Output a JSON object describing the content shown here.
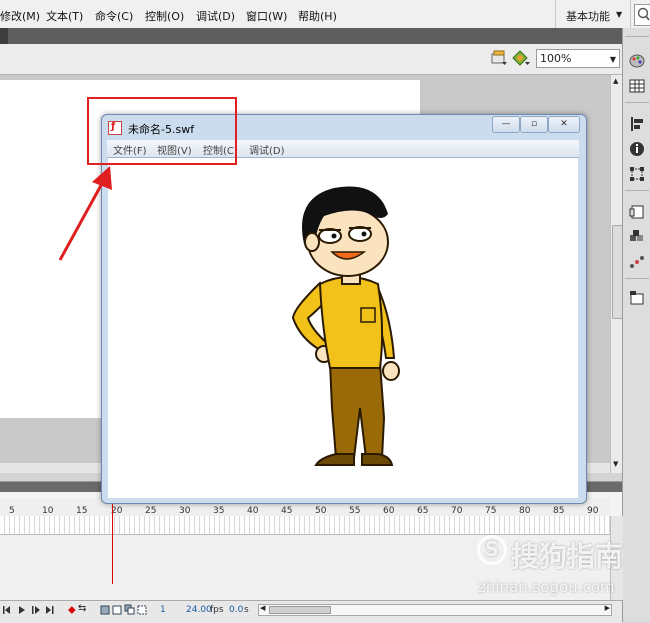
{
  "app": {
    "menu": [
      "修改(M)",
      "文本(T)",
      "命令(C)",
      "控制(O)",
      "调试(D)",
      "窗口(W)",
      "帮助(H)"
    ],
    "workspace_label": "基本功能",
    "zoom_value": "100%"
  },
  "player_window": {
    "title": "未命名-5.swf",
    "menu": [
      "文件(F)",
      "视图(V)",
      "控制(C)",
      "调试(D)"
    ]
  },
  "timeline": {
    "ruler_ticks": [
      "5",
      "10",
      "15",
      "20",
      "25",
      "30",
      "35",
      "40",
      "45",
      "50",
      "55",
      "60",
      "65",
      "70",
      "75",
      "80",
      "85",
      "90"
    ],
    "current_frame": "1",
    "fps_value": "24.00",
    "fps_unit": "fps",
    "time_value": "0.0",
    "time_unit": "s"
  },
  "watermark": {
    "line1": "搜狗指南",
    "line2": "zhinan.sogou.com"
  },
  "colors": {
    "annotation_red": "#e02020",
    "shirt_yellow": "#f2c21a",
    "pants_brown": "#9a6a08",
    "skin": "#fbe3c0"
  },
  "icons": [
    "edit-scene-icon",
    "edit-symbol-icon",
    "swatches-icon",
    "grid-icon",
    "align-icon",
    "info-icon",
    "transform-icon",
    "components-icon",
    "library-icon",
    "motion-presets-icon",
    "project-icon",
    "play-icon",
    "stop-icon",
    "arrow-annotation"
  ]
}
